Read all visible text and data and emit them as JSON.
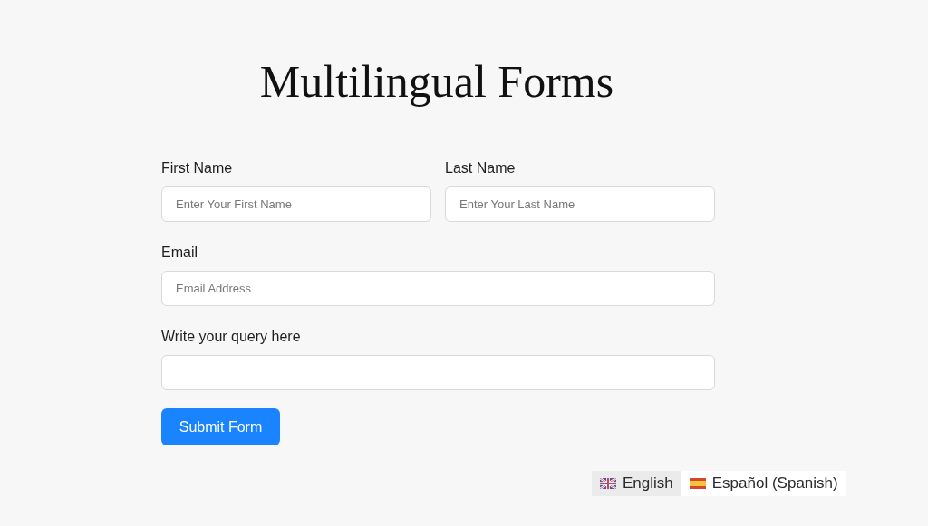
{
  "title": "Multilingual Forms",
  "fields": [
    {
      "label": "First Name",
      "placeholder": "Enter Your First Name"
    },
    {
      "label": "Last Name",
      "placeholder": "Enter Your Last Name"
    },
    {
      "label": "Email",
      "placeholder": "Email Address"
    },
    {
      "label": "Write your query here"
    }
  ],
  "submit": "Submit Form",
  "languages": [
    {
      "label": "English",
      "kind": "uk",
      "selected": true
    },
    {
      "label": "Español (Spanish)",
      "kind": "es",
      "selected": false
    }
  ]
}
